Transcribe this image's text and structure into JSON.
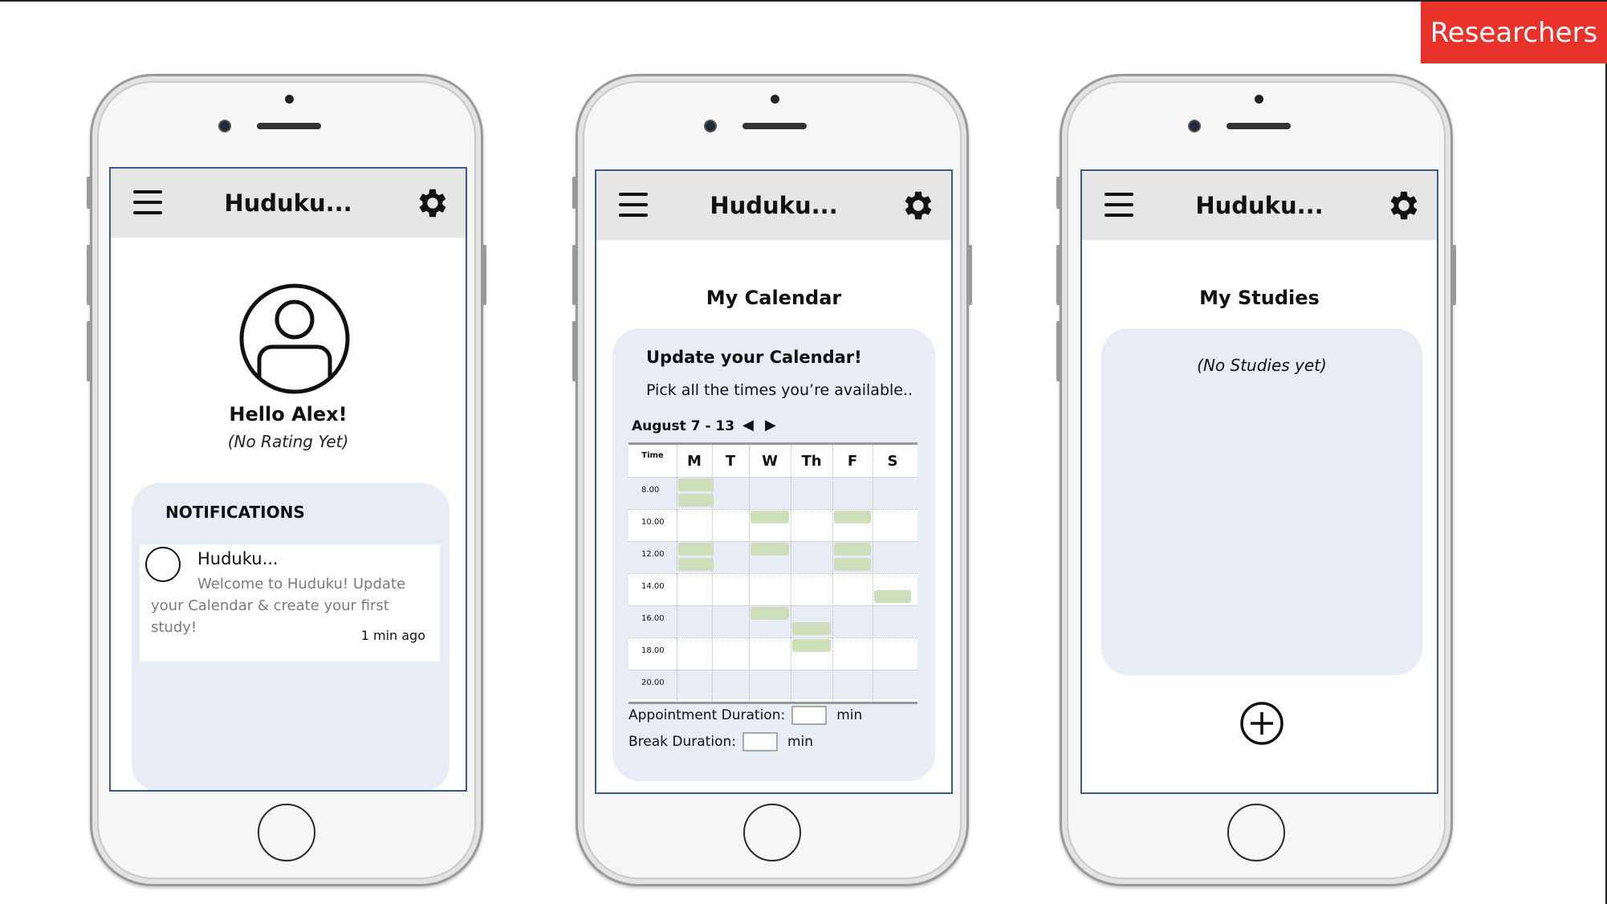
{
  "badge": {
    "label": "Researchers",
    "color": "#e8322a"
  },
  "app": {
    "title": "Huduku..."
  },
  "icons": {
    "menu": "hamburger-menu-icon",
    "settings": "gear-icon",
    "avatar": "user-avatar-icon",
    "add": "plus-circle-icon",
    "prev": "◀",
    "next": "▶"
  },
  "profile_screen": {
    "greeting": "Hello Alex!",
    "rating": "(No Rating Yet)",
    "notifications": {
      "title": "NOTIFICATIONS",
      "items": [
        {
          "sender": "Huduku...",
          "message": "Welcome to Huduku! Update your Calendar & create your first study!",
          "time": "1 min ago"
        }
      ]
    }
  },
  "calendar_screen": {
    "title": "My Calendar",
    "heading": "Update your Calendar!",
    "subheading": "Pick all the times you’re available..",
    "week_label": "August 7 - 13",
    "time_header": "Time",
    "days": [
      "M",
      "T",
      "W",
      "Th",
      "F",
      "S"
    ],
    "times": [
      "8.00",
      "10.00",
      "12.00",
      "14.00",
      "16.00",
      "18.00",
      "20.00"
    ],
    "available_slots": [
      {
        "day": "M",
        "time": "8.00",
        "half": "first"
      },
      {
        "day": "M",
        "time": "8.00",
        "half": "second"
      },
      {
        "day": "M",
        "time": "12.00",
        "half": "first"
      },
      {
        "day": "M",
        "time": "12.00",
        "half": "second"
      },
      {
        "day": "W",
        "time": "10.00",
        "half": "first"
      },
      {
        "day": "W",
        "time": "12.00",
        "half": "first"
      },
      {
        "day": "W",
        "time": "16.00",
        "half": "first"
      },
      {
        "day": "Th",
        "time": "16.00",
        "half": "second"
      },
      {
        "day": "Th",
        "time": "18.00",
        "half": "first"
      },
      {
        "day": "F",
        "time": "10.00",
        "half": "first"
      },
      {
        "day": "F",
        "time": "12.00",
        "half": "first"
      },
      {
        "day": "F",
        "time": "12.00",
        "half": "second"
      },
      {
        "day": "S",
        "time": "14.00",
        "half": "second"
      }
    ],
    "slot_color": "#cddfba",
    "appointment_duration": {
      "label": "Appointment Duration:",
      "value": "",
      "unit": "min"
    },
    "break_duration": {
      "label": "Break Duration:",
      "value": "",
      "unit": "min"
    }
  },
  "studies_screen": {
    "title": "My Studies",
    "empty_text": "(No Studies yet)"
  }
}
